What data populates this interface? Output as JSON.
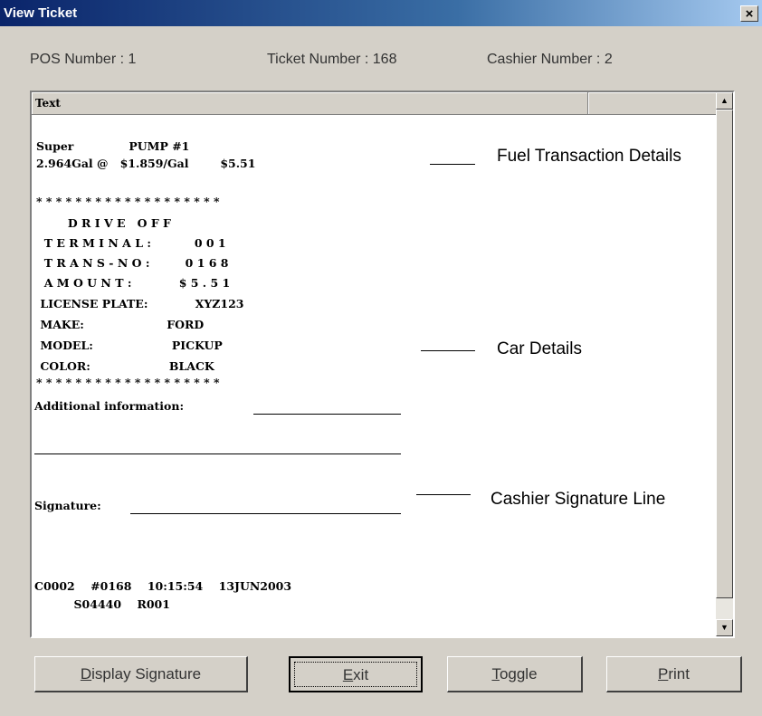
{
  "window": {
    "title": "View Ticket",
    "close_glyph": "×"
  },
  "info": {
    "pos": "POS Number : 1",
    "ticket": "Ticket Number : 168",
    "cashier": "Cashier Number : 2"
  },
  "list": {
    "column_header": "Text",
    "lines": [
      "Super              PUMP #1",
      "2.964Gal @   $1.859/Gal        $5.51",
      "* * * * * * * * * * * * * * * * * * *",
      "        D R I V E   O F F",
      "  T E R M I N A L :           0 0 1",
      "  T R A N S - N O :         0 1 6 8",
      "  A M O U N T :            $ 5 . 5 1",
      " LICENSE PLATE:            XYZ123",
      " MAKE:                     FORD",
      " MODEL:                    PICKUP",
      " COLOR:                    BLACK",
      "* * * * * * * * * * * * * * * * * * *",
      "Additional information:",
      "Signature:",
      "C0002    #0168    10:15:54    13JUN2003",
      "          S04440    R001"
    ]
  },
  "annotations": {
    "fuel": "Fuel Transaction Details",
    "car": "Car Details",
    "signature": "Cashier Signature Line"
  },
  "buttons": {
    "display_signature": {
      "mnemonic": "D",
      "rest": "isplay Signature"
    },
    "exit": {
      "mnemonic": "E",
      "rest": "xit"
    },
    "toggle": {
      "mnemonic": "T",
      "rest": "oggle"
    },
    "print": {
      "mnemonic": "P",
      "rest": "rint"
    }
  },
  "icons": {
    "scroll_up": "▲",
    "scroll_down": "▼"
  }
}
